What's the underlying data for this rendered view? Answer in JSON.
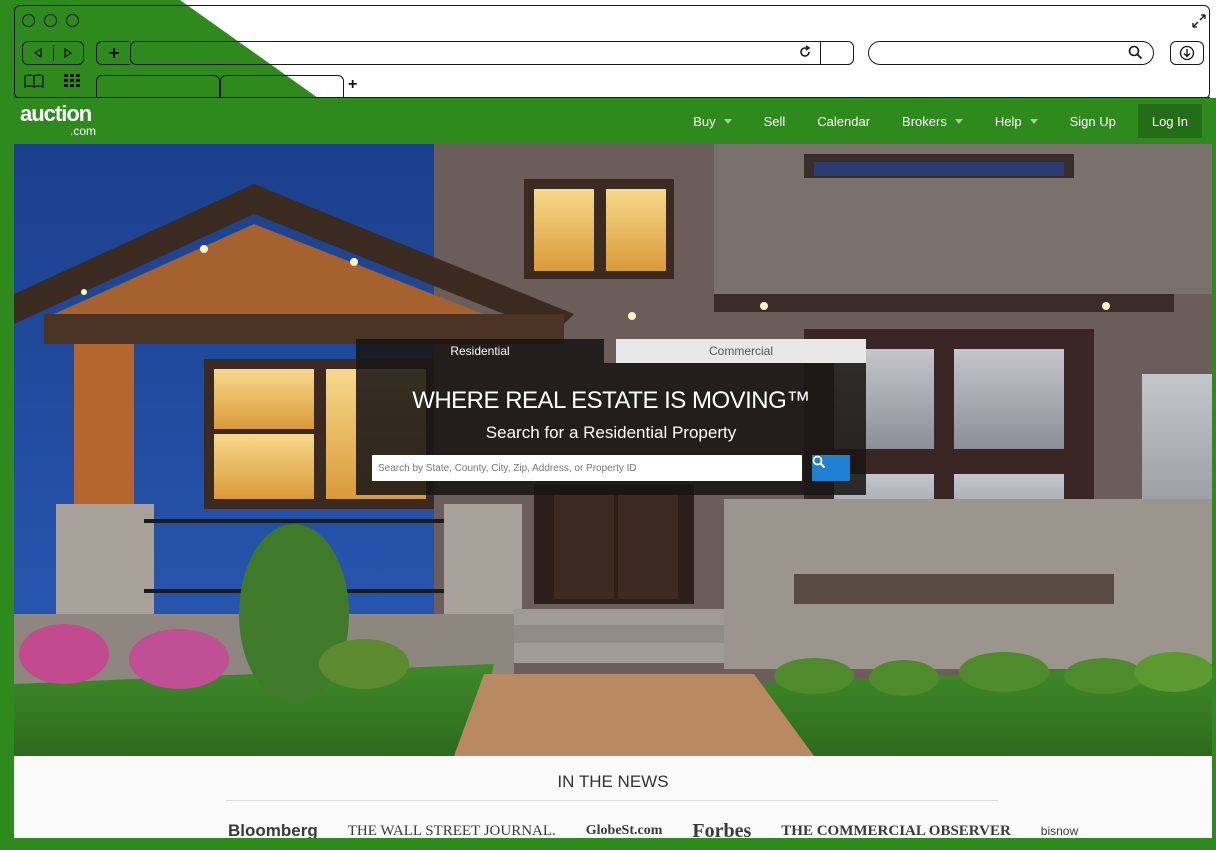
{
  "browser": {
    "new_tab_symbol": "+",
    "reload_icon": "reload-icon",
    "search_icon": "magnifier-icon",
    "download_icon": "download-icon"
  },
  "site": {
    "logo_main": "auction",
    "logo_sub": ".com",
    "brand_color": "#2f8a1d",
    "nav": [
      {
        "label": "Buy",
        "dropdown": true
      },
      {
        "label": "Sell",
        "dropdown": false
      },
      {
        "label": "Calendar",
        "dropdown": false
      },
      {
        "label": "Brokers",
        "dropdown": true
      },
      {
        "label": "Help",
        "dropdown": true
      },
      {
        "label": "Sign Up",
        "dropdown": false
      }
    ],
    "login_label": "Log In"
  },
  "search_panel": {
    "tabs": {
      "residential": "Residential",
      "commercial": "Commercial"
    },
    "headline": "WHERE REAL ESTATE IS MOVING™",
    "subheadline": "Search for a Residential Property",
    "placeholder": "Search by State, County, City, Zip, Address, or Property ID",
    "button_color": "#1f7fd0"
  },
  "news": {
    "title": "IN THE NEWS",
    "logos": [
      "Bloomberg",
      "THE WALL STREET JOURNAL.",
      "GlobeSt.com",
      "Forbes",
      "THE COMMERCIAL OBSERVER",
      "bisnow"
    ]
  }
}
